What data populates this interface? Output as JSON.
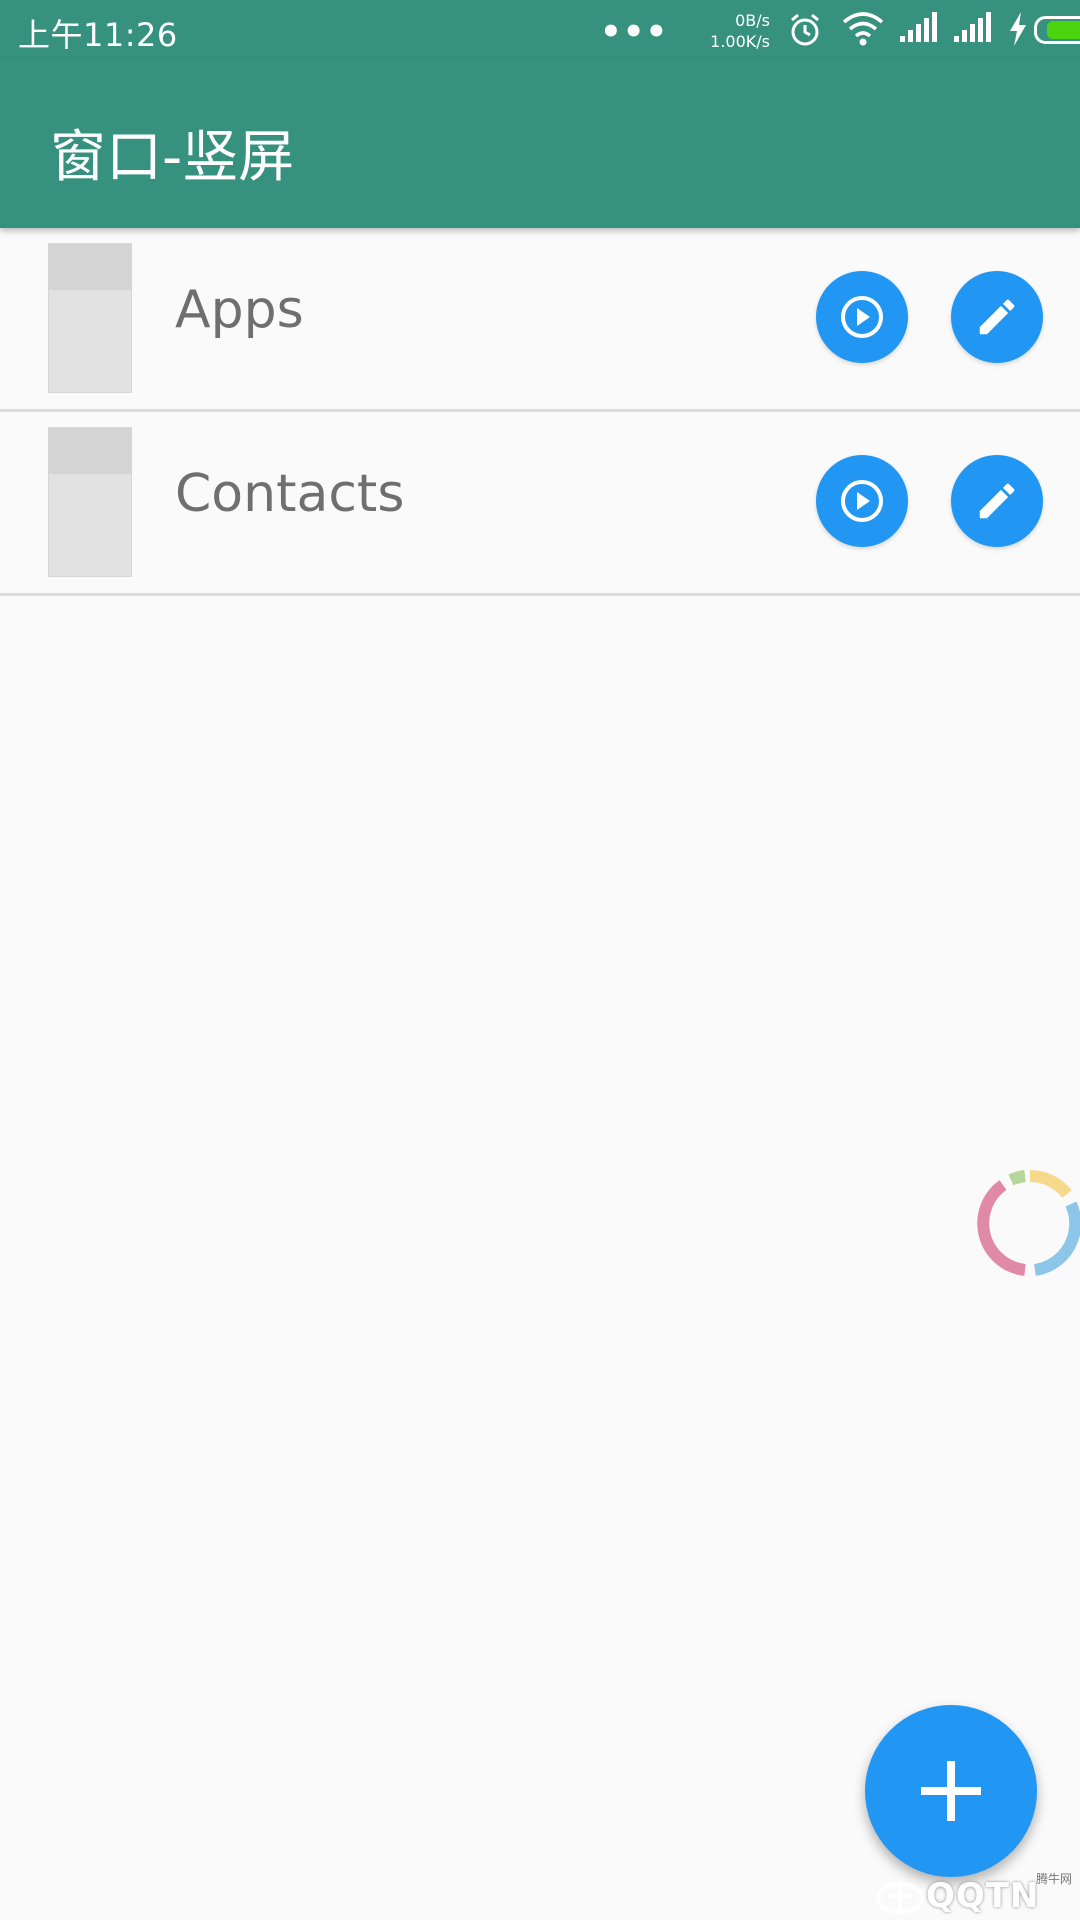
{
  "status_bar": {
    "time": "上午11:26",
    "dots": "•••",
    "net_up": "0B/s",
    "net_down": "1.00K/s",
    "icons": [
      "alarm-icon",
      "wifi-icon",
      "signal-icon",
      "signal-icon",
      "charging-icon",
      "battery-icon"
    ],
    "battery_level": 0.85
  },
  "app_bar": {
    "title": "窗口-竖屏"
  },
  "items": [
    {
      "label": "Apps"
    },
    {
      "label": "Contacts"
    }
  ],
  "colors": {
    "primary": "#37917f",
    "accent": "#2196f3",
    "battery": "#4cd40f"
  },
  "fab": {
    "icon": "plus-icon"
  },
  "watermark": {
    "text": "QQTN",
    "small": "腾牛网"
  }
}
